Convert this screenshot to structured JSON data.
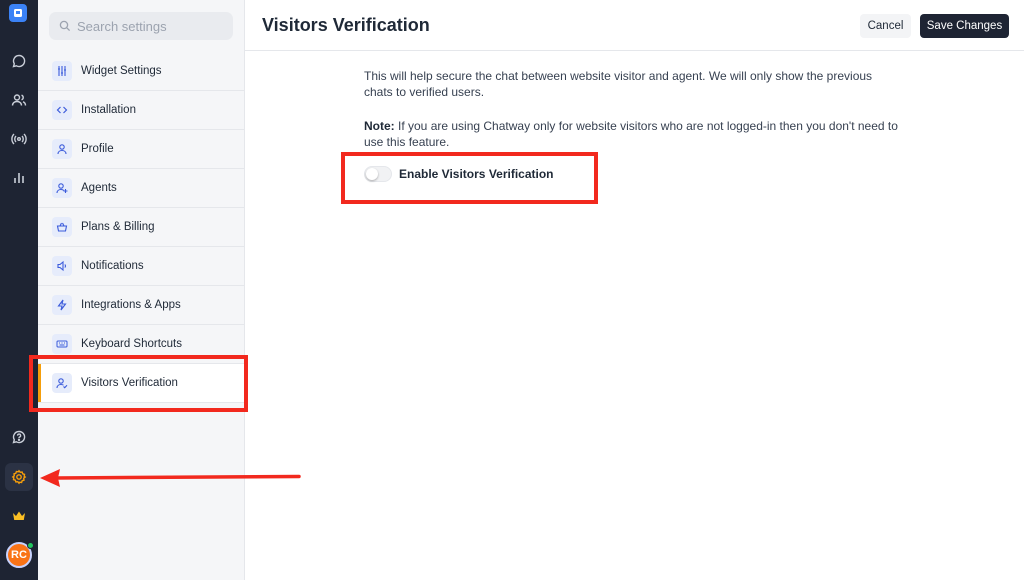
{
  "rail": {
    "icons": [
      "logo-icon",
      "chat-icon",
      "contacts-icon",
      "broadcast-icon",
      "analytics-icon",
      "help-icon",
      "settings-icon",
      "crown-icon"
    ],
    "avatar_initials": "RC",
    "accent": "#3b82f6",
    "active_color": "#f59e0b"
  },
  "panel": {
    "search_placeholder": "Search settings",
    "items": [
      {
        "label": "Widget Settings",
        "icon": "sliders-icon"
      },
      {
        "label": "Installation",
        "icon": "code-icon"
      },
      {
        "label": "Profile",
        "icon": "user-icon"
      },
      {
        "label": "Agents",
        "icon": "user-plus-icon"
      },
      {
        "label": "Plans & Billing",
        "icon": "basket-icon"
      },
      {
        "label": "Notifications",
        "icon": "speaker-icon"
      },
      {
        "label": "Integrations & Apps",
        "icon": "bolt-icon"
      },
      {
        "label": "Keyboard Shortcuts",
        "icon": "keyboard-icon"
      },
      {
        "label": "Visitors Verification",
        "icon": "user-check-icon"
      }
    ]
  },
  "main": {
    "title": "Visitors Verification",
    "cancel_label": "Cancel",
    "save_label": "Save Changes",
    "description": "This will help secure the chat between website visitor and agent. We will only show the previous chats to verified users.",
    "note_label": "Note:",
    "note_text": " If you are using Chatway only for website visitors who are not logged-in then you don't need to use this feature.",
    "toggle_label": "Enable Visitors Verification",
    "toggle_on": false
  },
  "annotation_color": "#f2291e"
}
